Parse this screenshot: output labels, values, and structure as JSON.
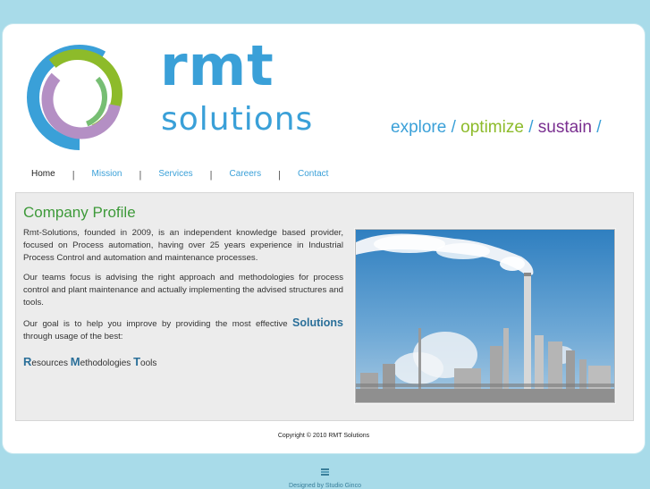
{
  "brand": {
    "name_top": "rmt",
    "name_bottom": "solutions",
    "tagline": {
      "word1": "explore",
      "word2": "optimize",
      "word3": "sustain",
      "separator": " / "
    },
    "colors": {
      "blue": "#3aa0d8",
      "green": "#8dbb2a",
      "purple": "#7a2f90",
      "title_green": "#3e9a3a"
    }
  },
  "nav": {
    "items": [
      {
        "label": "Home"
      },
      {
        "label": "Mission"
      },
      {
        "label": "Services"
      },
      {
        "label": "Careers"
      },
      {
        "label": "Contact"
      }
    ],
    "separator": "|"
  },
  "content": {
    "title": "Company Profile",
    "para1": "Rmt-Solutions, founded in 2009, is an independent knowledge based provider, focused on Process automation, having over 25 years experience in Industrial Process Control and automation and maintenance processes.",
    "para2": "Our teams focus is advising the right approach and methodologies for process control and plant maintenance and actually implementing the advised structures and tools.",
    "para3_start": "Our goal is to help you improve by providing the most effective ",
    "para3_strong": "Solutions",
    "para3_end": " through usage of the best:",
    "rmt": {
      "r_cap": "R",
      "r_rest": "esources ",
      "m_cap": "M",
      "m_rest": "ethodologies ",
      "t_cap": "T",
      "t_rest": "ools"
    }
  },
  "footer": {
    "copyright": "Copyright © 2010 RMT Solutions",
    "designed_by": "Designed by Studio Ginco"
  }
}
